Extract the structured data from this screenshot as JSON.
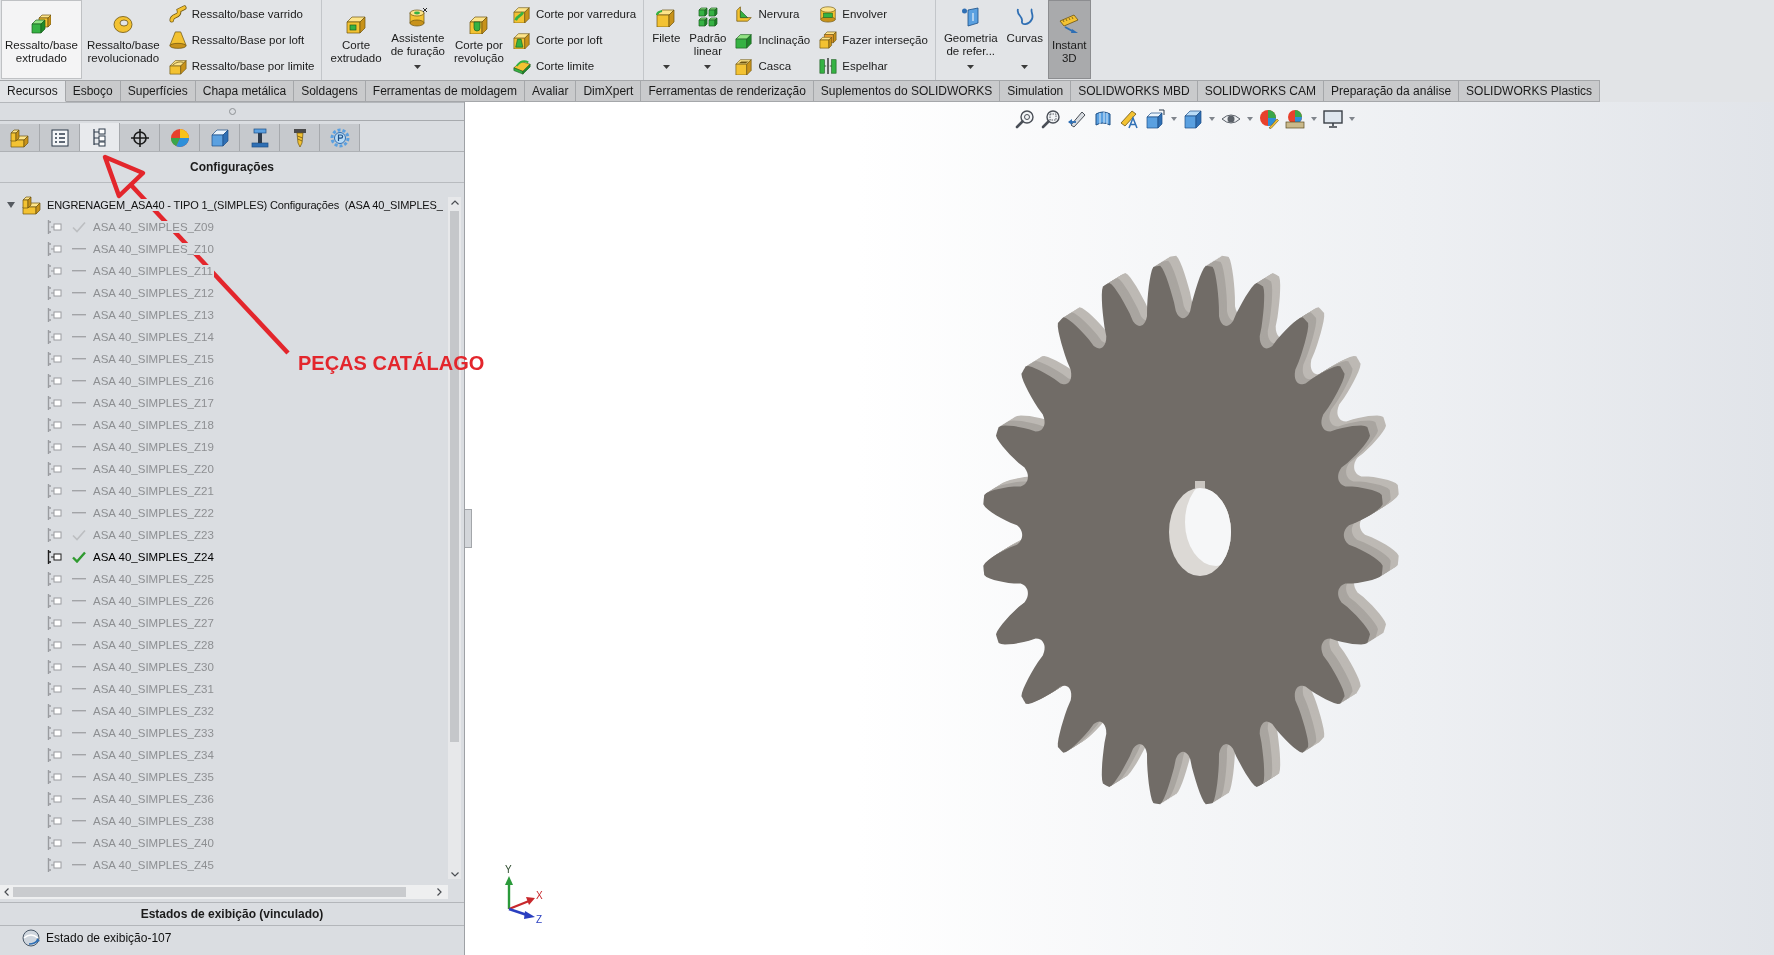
{
  "ribbon": {
    "groups": [
      {
        "commands": [
          {
            "kind": "large",
            "label": "Ressalto/base\nextrudado",
            "hovered": true,
            "on": false,
            "dropdown": false
          },
          {
            "kind": "large",
            "label": "Ressalto/base\nrevolucionado",
            "hovered": false,
            "on": false,
            "dropdown": false
          },
          {
            "kind": "stack",
            "items": [
              {
                "label": "Ressalto/base varrido"
              },
              {
                "label": "Ressalto/Base por loft"
              },
              {
                "label": "Ressalto/base por limite"
              }
            ]
          }
        ]
      },
      {
        "commands": [
          {
            "kind": "large",
            "label": "Corte\nextrudado",
            "hovered": false,
            "on": false,
            "dropdown": false
          },
          {
            "kind": "large",
            "label": "Assistente\nde furação",
            "hovered": false,
            "on": false,
            "dropdown": true
          },
          {
            "kind": "large",
            "label": "Corte por\nrevolução",
            "hovered": false,
            "on": false,
            "dropdown": false
          },
          {
            "kind": "stack",
            "items": [
              {
                "label": "Corte por varredura"
              },
              {
                "label": "Corte por loft"
              },
              {
                "label": "Corte limite"
              }
            ]
          }
        ]
      },
      {
        "commands": [
          {
            "kind": "large",
            "label": "Filete",
            "hovered": false,
            "on": false,
            "dropdown": true
          },
          {
            "kind": "large",
            "label": "Padrão\nlinear",
            "hovered": false,
            "on": false,
            "dropdown": true
          },
          {
            "kind": "stack",
            "items": [
              {
                "label": "Nervura"
              },
              {
                "label": "Inclinação"
              },
              {
                "label": "Casca"
              }
            ]
          },
          {
            "kind": "stack",
            "items": [
              {
                "label": "Envolver"
              },
              {
                "label": "Fazer interseção"
              },
              {
                "label": "Espelhar"
              }
            ]
          }
        ]
      },
      {
        "commands": [
          {
            "kind": "large",
            "label": "Geometria\nde refer...",
            "hovered": false,
            "on": false,
            "dropdown": true
          },
          {
            "kind": "large",
            "label": "Curvas",
            "hovered": false,
            "on": false,
            "dropdown": true
          },
          {
            "kind": "large",
            "label": "Instant\n3D",
            "hovered": false,
            "on": true,
            "dropdown": false
          }
        ]
      }
    ]
  },
  "command_tabs": [
    {
      "label": "Recursos",
      "selected": true
    },
    {
      "label": "Esboço",
      "selected": false
    },
    {
      "label": "Superfícies",
      "selected": false
    },
    {
      "label": "Chapa metálica",
      "selected": false
    },
    {
      "label": "Soldagens",
      "selected": false
    },
    {
      "label": "Ferramentas de moldagem",
      "selected": false
    },
    {
      "label": "Avaliar",
      "selected": false
    },
    {
      "label": "DimXpert",
      "selected": false
    },
    {
      "label": "Ferramentas de renderização",
      "selected": false
    },
    {
      "label": "Suplementos do SOLIDWORKS",
      "selected": false
    },
    {
      "label": "Simulation",
      "selected": false
    },
    {
      "label": "SOLIDWORKS MBD",
      "selected": false
    },
    {
      "label": "SOLIDWORKS CAM",
      "selected": false
    },
    {
      "label": "Preparação da análise",
      "selected": false
    },
    {
      "label": "SOLIDWORKS Plastics",
      "selected": false
    }
  ],
  "panel": {
    "tabs": [
      {
        "selected": false
      },
      {
        "selected": false
      },
      {
        "selected": true
      },
      {
        "selected": false
      },
      {
        "selected": false
      },
      {
        "selected": false
      },
      {
        "selected": false
      },
      {
        "selected": false
      },
      {
        "selected": false
      }
    ],
    "title": "Configurações",
    "tree": {
      "label": "ENGRENAGEM_ASA40 - TIPO 1_(SIMPLES) Configurações  (ASA 40_SIMPLES_",
      "expanded": true,
      "children": [
        {
          "label": "ASA 40_SIMPLES_Z09",
          "kind": "check",
          "selected": false
        },
        {
          "label": "ASA 40_SIMPLES_Z10",
          "kind": "dash",
          "selected": false
        },
        {
          "label": "ASA 40_SIMPLES_Z11",
          "kind": "dash",
          "selected": false
        },
        {
          "label": "ASA 40_SIMPLES_Z12",
          "kind": "dash",
          "selected": false
        },
        {
          "label": "ASA 40_SIMPLES_Z13",
          "kind": "dash",
          "selected": false
        },
        {
          "label": "ASA 40_SIMPLES_Z14",
          "kind": "dash",
          "selected": false
        },
        {
          "label": "ASA 40_SIMPLES_Z15",
          "kind": "dash",
          "selected": false
        },
        {
          "label": "ASA 40_SIMPLES_Z16",
          "kind": "dash",
          "selected": false
        },
        {
          "label": "ASA 40_SIMPLES_Z17",
          "kind": "dash",
          "selected": false
        },
        {
          "label": "ASA 40_SIMPLES_Z18",
          "kind": "dash",
          "selected": false
        },
        {
          "label": "ASA 40_SIMPLES_Z19",
          "kind": "dash",
          "selected": false
        },
        {
          "label": "ASA 40_SIMPLES_Z20",
          "kind": "dash",
          "selected": false
        },
        {
          "label": "ASA 40_SIMPLES_Z21",
          "kind": "dash",
          "selected": false
        },
        {
          "label": "ASA 40_SIMPLES_Z22",
          "kind": "dash",
          "selected": false
        },
        {
          "label": "ASA 40_SIMPLES_Z23",
          "kind": "check",
          "selected": false
        },
        {
          "label": "ASA 40_SIMPLES_Z24",
          "kind": "check",
          "selected": true
        },
        {
          "label": "ASA 40_SIMPLES_Z25",
          "kind": "dash",
          "selected": false
        },
        {
          "label": "ASA 40_SIMPLES_Z26",
          "kind": "dash",
          "selected": false
        },
        {
          "label": "ASA 40_SIMPLES_Z27",
          "kind": "dash",
          "selected": false
        },
        {
          "label": "ASA 40_SIMPLES_Z28",
          "kind": "dash",
          "selected": false
        },
        {
          "label": "ASA 40_SIMPLES_Z30",
          "kind": "dash",
          "selected": false
        },
        {
          "label": "ASA 40_SIMPLES_Z31",
          "kind": "dash",
          "selected": false
        },
        {
          "label": "ASA 40_SIMPLES_Z32",
          "kind": "dash",
          "selected": false
        },
        {
          "label": "ASA 40_SIMPLES_Z33",
          "kind": "dash",
          "selected": false
        },
        {
          "label": "ASA 40_SIMPLES_Z34",
          "kind": "dash",
          "selected": false
        },
        {
          "label": "ASA 40_SIMPLES_Z35",
          "kind": "dash",
          "selected": false
        },
        {
          "label": "ASA 40_SIMPLES_Z36",
          "kind": "dash",
          "selected": false
        },
        {
          "label": "ASA 40_SIMPLES_Z38",
          "kind": "dash",
          "selected": false
        },
        {
          "label": "ASA 40_SIMPLES_Z40",
          "kind": "dash",
          "selected": false
        },
        {
          "label": "ASA 40_SIMPLES_Z45",
          "kind": "dash",
          "selected": false
        }
      ]
    },
    "display_states": {
      "title": "Estados de exibição (vinculado)",
      "items": [
        {
          "label": "Estado de exibição-107"
        }
      ]
    }
  },
  "triad": {
    "labels": [
      "Y",
      "X",
      "Z"
    ]
  },
  "annotation": {
    "text": "PEÇAS CATÁLAGO"
  }
}
